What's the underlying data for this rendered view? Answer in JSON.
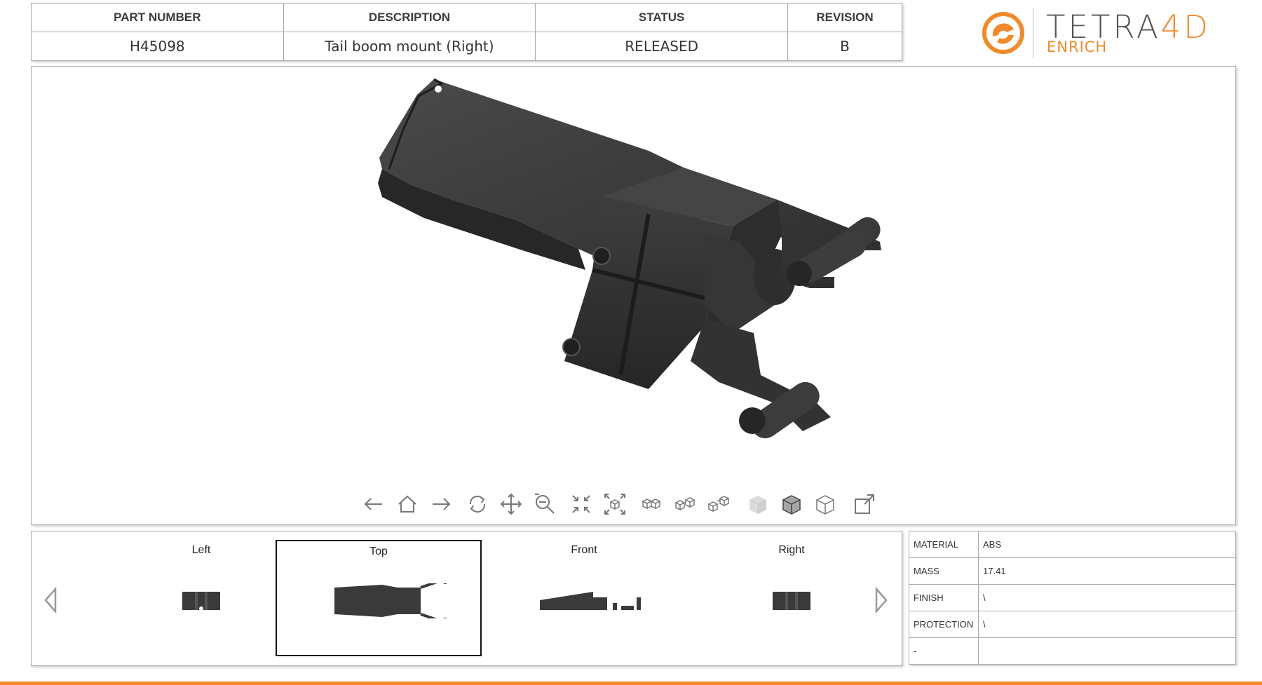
{
  "header": {
    "columns": [
      "PART NUMBER",
      "DESCRIPTION",
      "STATUS",
      "REVISION"
    ],
    "values": [
      "H45098",
      "Tail boom mount (Right)",
      "RELEASED",
      "B"
    ]
  },
  "logo": {
    "brand_main": "TETRA",
    "brand_accent": "4D",
    "sub": "ENRICH",
    "accent_color": "#f08a2b",
    "icon": "tetra4d-logo-icon"
  },
  "toolbar": {
    "buttons": [
      {
        "name": "back-icon"
      },
      {
        "name": "home-icon"
      },
      {
        "name": "forward-icon"
      },
      {
        "name": "rotate-icon"
      },
      {
        "name": "pan-icon"
      },
      {
        "name": "zoom-icon"
      },
      {
        "name": "fit-all-icon"
      },
      {
        "name": "fit-selection-icon"
      },
      {
        "name": "explode-1-icon"
      },
      {
        "name": "explode-2-icon"
      },
      {
        "name": "explode-3-icon"
      },
      {
        "name": "shaded-render-icon"
      },
      {
        "name": "shaded-edges-render-icon"
      },
      {
        "name": "wireframe-render-icon"
      },
      {
        "name": "fullscreen-icon"
      }
    ]
  },
  "views": {
    "items": [
      {
        "label": "Left",
        "selected": false
      },
      {
        "label": "Top",
        "selected": true
      },
      {
        "label": "Front",
        "selected": false
      },
      {
        "label": "Right",
        "selected": false
      }
    ],
    "prev_icon": "chevron-left-icon",
    "next_icon": "chevron-right-icon"
  },
  "properties": {
    "rows": [
      {
        "key": "MATERIAL",
        "value": "ABS"
      },
      {
        "key": "MASS",
        "value": "17.41"
      },
      {
        "key": "FINISH",
        "value": "\\"
      },
      {
        "key": "PROTECTION",
        "value": "\\"
      },
      {
        "key": "-",
        "value": ""
      }
    ]
  },
  "colors": {
    "accent": "#f08a2b",
    "model": "#3b3b3b",
    "border": "#a9a9a9"
  }
}
